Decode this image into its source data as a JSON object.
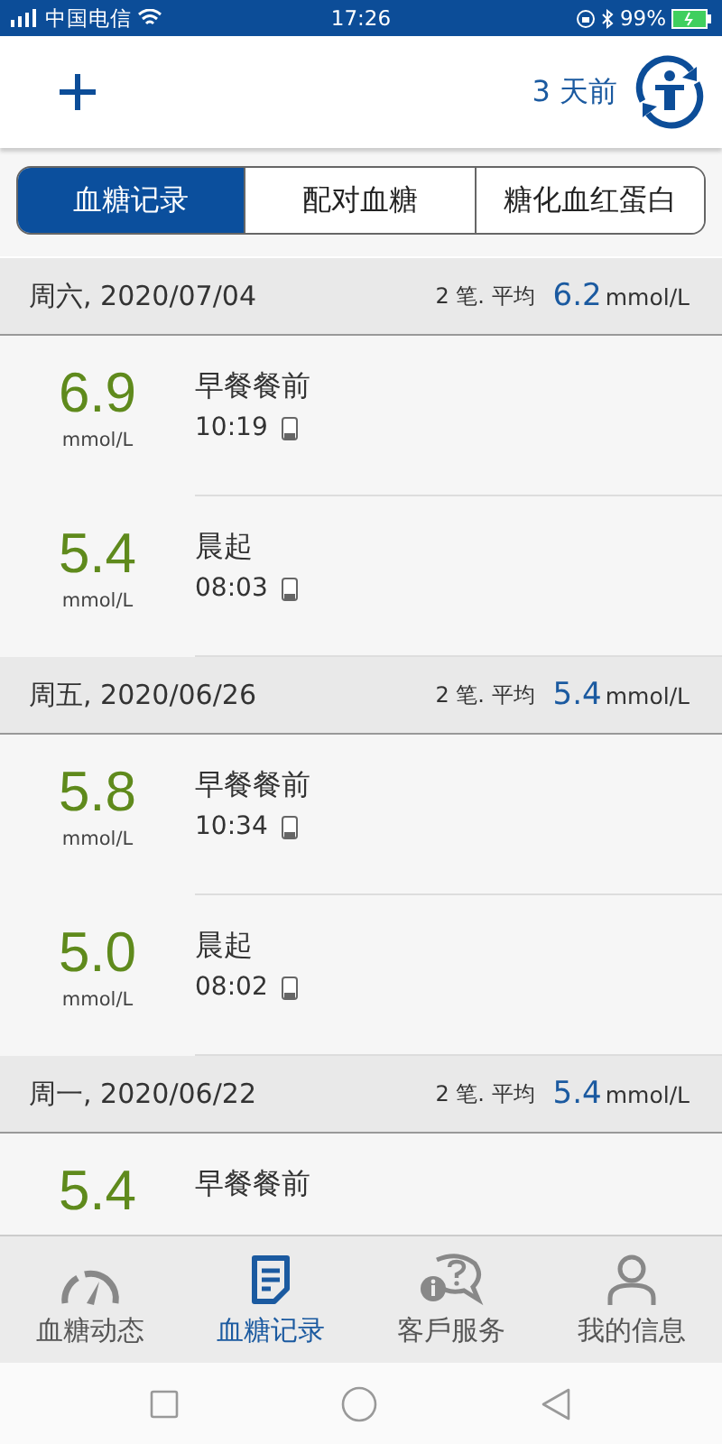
{
  "status_bar": {
    "carrier": "中国电信",
    "time": "17:26",
    "battery": "99%"
  },
  "header": {
    "since": "3 天前"
  },
  "tabs": [
    {
      "label": "血糖记录",
      "selected": true
    },
    {
      "label": "配对血糖",
      "selected": false
    },
    {
      "label": "糖化血红蛋白",
      "selected": false
    }
  ],
  "groups": [
    {
      "date": "周六, 2020/07/04",
      "count": "2 笔. 平均",
      "average": "6.2",
      "average_unit": "mmol/L",
      "entries": [
        {
          "value": "6.9",
          "unit": "mmol/L",
          "label": "早餐餐前",
          "time": "10:19"
        },
        {
          "value": "5.4",
          "unit": "mmol/L",
          "label": "晨起",
          "time": "08:03"
        }
      ]
    },
    {
      "date": "周五, 2020/06/26",
      "count": "2 笔. 平均",
      "average": "5.4",
      "average_unit": "mmol/L",
      "entries": [
        {
          "value": "5.8",
          "unit": "mmol/L",
          "label": "早餐餐前",
          "time": "10:34"
        },
        {
          "value": "5.0",
          "unit": "mmol/L",
          "label": "晨起",
          "time": "08:02"
        }
      ]
    },
    {
      "date": "周一, 2020/06/22",
      "count": "2 笔. 平均",
      "average": "5.4",
      "average_unit": "mmol/L",
      "entries": [
        {
          "value": "5.4",
          "label": "早餐餐前"
        }
      ]
    }
  ],
  "bottom_nav": [
    {
      "label": "血糖动态",
      "kind": "gauge",
      "selected": false
    },
    {
      "label": "血糖记录",
      "kind": "note",
      "selected": true
    },
    {
      "label": "客戶服务",
      "kind": "chat",
      "selected": false
    },
    {
      "label": "我的信息",
      "kind": "person",
      "selected": false
    }
  ]
}
